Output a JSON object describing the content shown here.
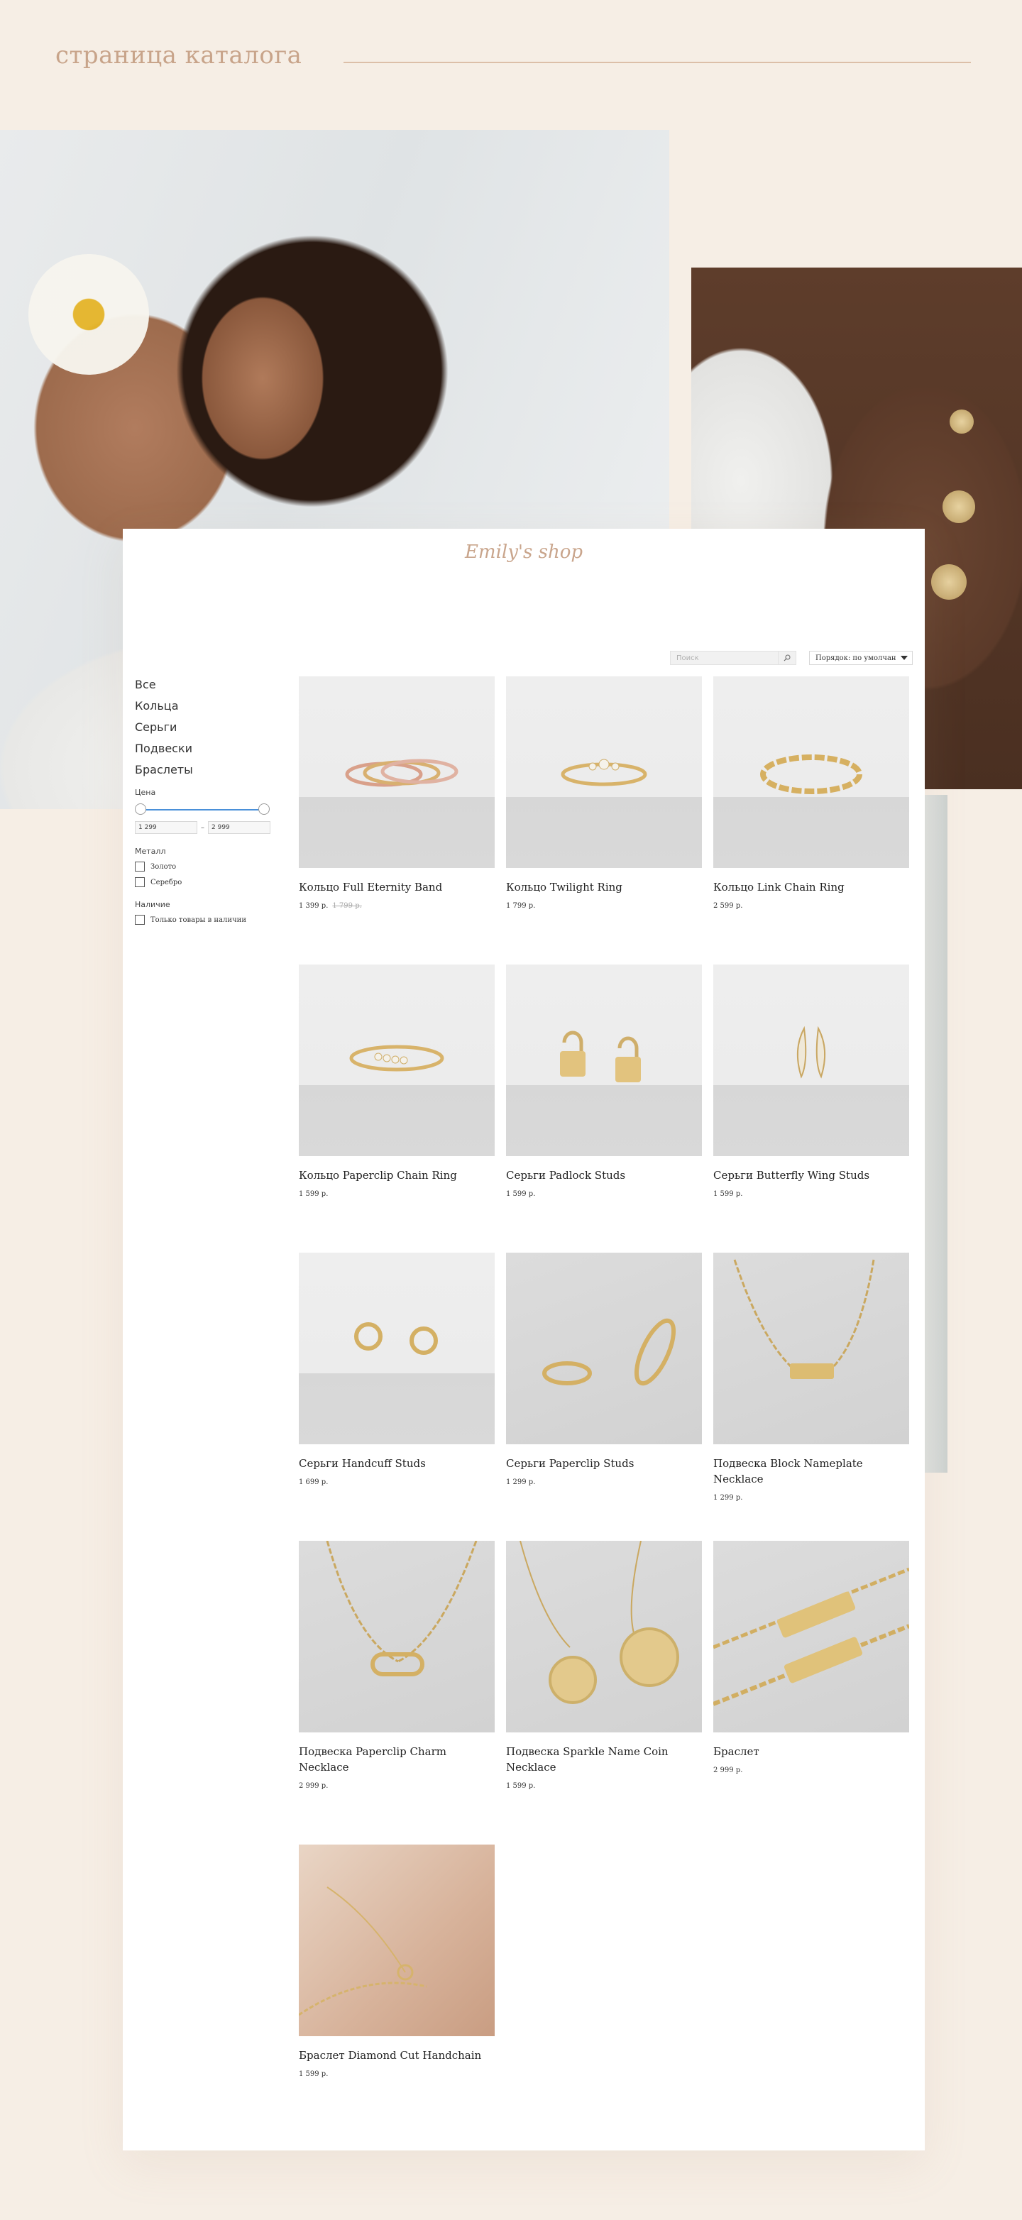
{
  "page": {
    "heading": "страница каталога"
  },
  "shop": {
    "logo": "Emily's shop"
  },
  "toolbar": {
    "search_placeholder": "Поиск",
    "sort_label": "Порядок: по умолчан"
  },
  "sidebar": {
    "categories": [
      {
        "label": "Все"
      },
      {
        "label": "Кольца"
      },
      {
        "label": "Серьги"
      },
      {
        "label": "Подвески"
      },
      {
        "label": "Браслеты"
      }
    ],
    "price": {
      "title": "Цена",
      "min": "1 299",
      "max": "2 999"
    },
    "metal": {
      "title": "Металл",
      "options": [
        {
          "label": "Золото"
        },
        {
          "label": "Серебро"
        }
      ]
    },
    "stock": {
      "title": "Наличие",
      "option": "Только товары в наличии"
    }
  },
  "products": [
    {
      "title": "Кольцо Full Eternity Band",
      "price": "1 399 р.",
      "old_price": "1 799 р."
    },
    {
      "title": "Кольцо Twilight Ring",
      "price": "1 799 р."
    },
    {
      "title": "Кольцо Link Chain Ring",
      "price": "2 599 р."
    },
    {
      "title": "Кольцо Paperclip Chain Ring",
      "price": "1 599 р."
    },
    {
      "title": "Серьги Padlock Studs",
      "price": "1 599 р."
    },
    {
      "title": "Серьги Butterfly Wing Studs",
      "price": "1 599 р."
    },
    {
      "title": "Серьги Handcuff Studs",
      "price": "1 699 р."
    },
    {
      "title": "Серьги Paperclip Studs",
      "price": "1 299 р."
    },
    {
      "title": "Подвеска Block Nameplate Necklace",
      "price": "1 299 р."
    },
    {
      "title": "Подвеска Paperclip Charm Necklace",
      "price": "2 999 р."
    },
    {
      "title": "Подвеска Sparkle Name Coin Necklace",
      "price": "1 599 р."
    },
    {
      "title": "Браслет",
      "price": "2 999 р."
    },
    {
      "title": "Браслет Diamond Cut Handchain",
      "price": "1 599 р."
    }
  ]
}
